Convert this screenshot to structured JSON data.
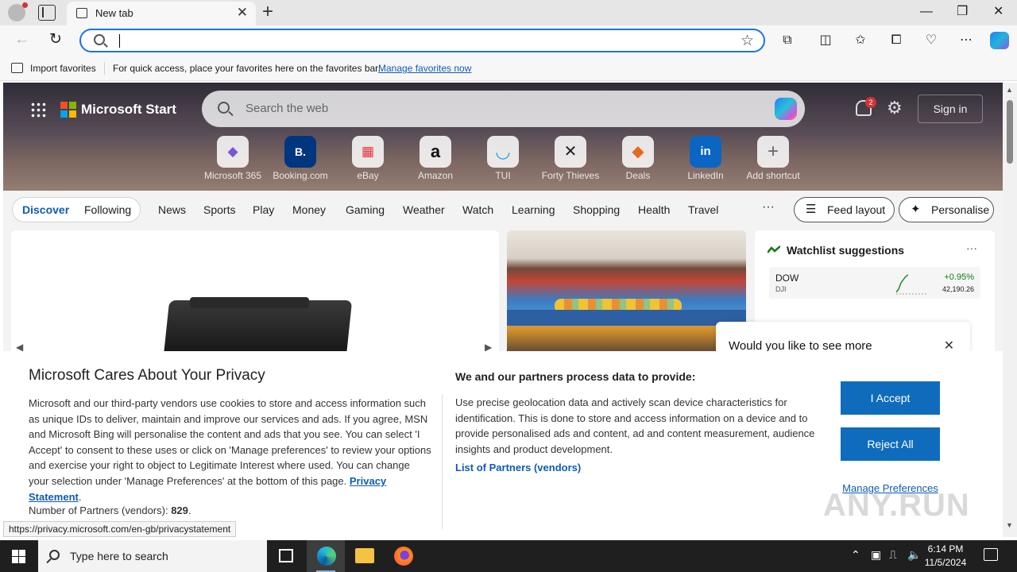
{
  "browser": {
    "tab_title": "New tab",
    "tab_close": "✕",
    "new_tab": "+",
    "window_controls": [
      "—",
      "❐",
      "✕"
    ],
    "address_value": "",
    "favorites_bar": {
      "import_label": "Import favorites",
      "hint_text": "For quick access, place your favorites here on the favorites bar.",
      "manage_link": "Manage favorites now"
    }
  },
  "hero": {
    "brand": "Microsoft Start",
    "search_placeholder": "Search the web",
    "notification_count": "2",
    "signin_label": "Sign in",
    "shortcuts": [
      {
        "label": "Microsoft 365",
        "glyph": "◆",
        "color": "#7a55d8"
      },
      {
        "label": "Booking.com",
        "glyph": "B.",
        "color": "#003580"
      },
      {
        "label": "eBay",
        "glyph": "▦",
        "color": "#e53238"
      },
      {
        "label": "Amazon",
        "glyph": "a",
        "color": "#111111"
      },
      {
        "label": "TUI",
        "glyph": "◡",
        "color": "#1aa1e0"
      },
      {
        "label": "Forty Thieves",
        "glyph": "✕",
        "color": "#222222"
      },
      {
        "label": "Deals",
        "glyph": "◆",
        "color": "#e06b1f"
      },
      {
        "label": "LinkedIn",
        "glyph": "in",
        "color": "#0a66c2"
      },
      {
        "label": "Add shortcut",
        "glyph": "+",
        "color": "#666666"
      }
    ]
  },
  "feed": {
    "segment": [
      "Discover",
      "Following"
    ],
    "tabs": [
      "News",
      "Sports",
      "Play",
      "Money",
      "Gaming",
      "Weather",
      "Watch",
      "Learning",
      "Shopping",
      "Health",
      "Travel"
    ],
    "more": "···",
    "feed_layout": "Feed layout",
    "personalise": "Personalise"
  },
  "watchlist": {
    "title": "Watchlist suggestions",
    "more": "···",
    "symbol": "DOW",
    "exchange": "DJI",
    "change": "+0.95%",
    "price": "42,190.26",
    "up_color": "#107c10"
  },
  "toast": {
    "text": "Would you like to see more",
    "close": "✕"
  },
  "consent": {
    "title": "Microsoft Cares About Your Privacy",
    "body": "Microsoft and our third-party vendors use cookies to store and access information such as unique IDs to deliver, maintain and improve our services and ads. If you agree, MSN and Microsoft Bing will personalise the content and ads that you see. You can select 'I Accept' to consent to these uses or click on 'Manage preferences' to review your options and exercise your right to object to Legitimate Interest where used.  You can change your selection under 'Manage Preferences' at the bottom of this page.",
    "privacy_link": "Privacy Statement",
    "partners_label": "Number of Partners (vendors):",
    "partners_count": "829",
    "purpose_title": "We and our partners process data to provide:",
    "purpose_body": "Use precise geolocation data and actively scan device characteristics for identification. This is done to store and access information on a device and to provide personalised ads and content, ad and content measurement, audience insights and product development.",
    "vendors_link": "List of Partners (vendors)",
    "accept": "I Accept",
    "reject": "Reject All",
    "manage": "Manage Preferences"
  },
  "status_url": "https://privacy.microsoft.com/en-gb/privacystatement",
  "watermark": "ANY.RUN",
  "taskbar": {
    "search_placeholder": "Type here to search",
    "time": "6:14 PM",
    "date": "11/5/2024"
  }
}
